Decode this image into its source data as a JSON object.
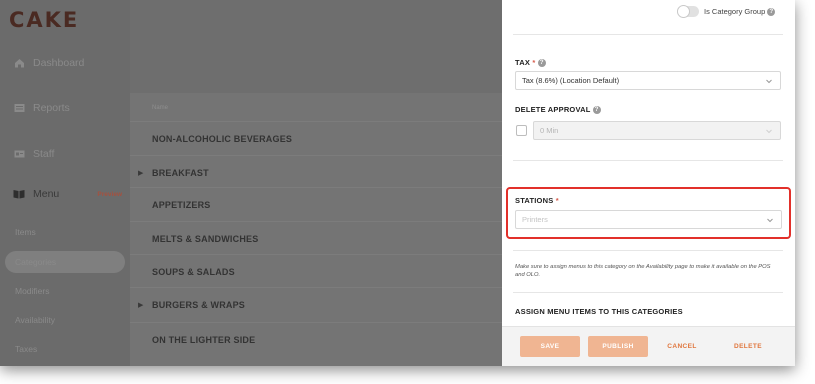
{
  "app": {
    "logo": "CAKE"
  },
  "sidebar": {
    "items": [
      {
        "label": "Dashboard",
        "icon": "home-icon"
      },
      {
        "label": "Reports",
        "icon": "reports-icon"
      },
      {
        "label": "Staff",
        "icon": "staff-icon"
      },
      {
        "label": "Menu",
        "icon": "menu-book-icon",
        "badge": "Preview"
      }
    ],
    "subitems": [
      {
        "label": "Items"
      },
      {
        "label": "Categories",
        "active": true
      },
      {
        "label": "Modifiers"
      },
      {
        "label": "Availability"
      },
      {
        "label": "Taxes"
      }
    ]
  },
  "list": {
    "column_header": "Name",
    "rows": [
      {
        "name": "NON-ALCOHOLIC BEVERAGES",
        "expandable": false
      },
      {
        "name": "BREAKFAST",
        "expandable": true
      },
      {
        "name": "APPETIZERS",
        "expandable": false
      },
      {
        "name": "MELTS & SANDWICHES",
        "expandable": false
      },
      {
        "name": "SOUPS & SALADS",
        "expandable": false
      },
      {
        "name": "BURGERS & WRAPS",
        "expandable": true
      },
      {
        "name": "ON THE LIGHTER SIDE",
        "expandable": false
      }
    ]
  },
  "panel": {
    "category_group_label": "Is Category Group",
    "category_group_on": false,
    "tax": {
      "label": "TAX",
      "required_mark": "*",
      "value": "Tax (8.6%) (Location Default)"
    },
    "delete_approval": {
      "label": "DELETE APPROVAL",
      "value": "0 Min",
      "checked": false
    },
    "stations": {
      "label": "STATIONS",
      "required_mark": "*",
      "placeholder": "Printers"
    },
    "note": "Make sure to assign menus to this category on the Availability page to make it available on the POS and OLO.",
    "assign_heading": "ASSIGN MENU ITEMS TO THIS CATEGORIES",
    "buttons": {
      "save": "SAVE",
      "publish": "PUBLISH",
      "cancel": "CANCEL",
      "delete": "DELETE"
    }
  },
  "colors": {
    "accent": "#e0763d",
    "button_fill": "#f0b592",
    "highlight": "#e2302a",
    "required": "#d65a4a"
  }
}
